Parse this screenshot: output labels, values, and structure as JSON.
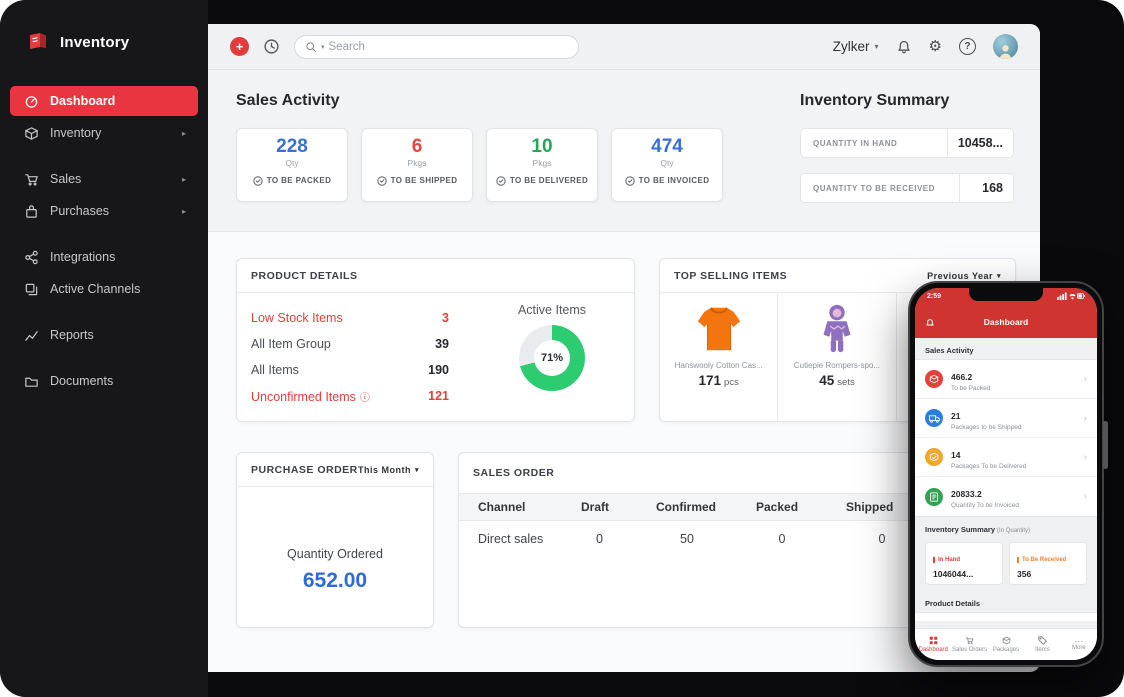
{
  "icons": {
    "plus": "+",
    "caret_down": "▾",
    "caret_right": "▸",
    "chevron_right": "›",
    "gear": "⚙",
    "question": "?",
    "info": "ⓘ",
    "dots": "⋯"
  },
  "colors": {
    "brand_red": "#e23b3b",
    "active_menu_red": "#e8353f",
    "blue_metric": "#3a6fd8",
    "red_metric": "#e8453c",
    "green_metric": "#27a45a",
    "donut_green": "#2ecc71",
    "donut_track": "#e9ebee",
    "alert_red": "#e0403a",
    "phone_header_red": "#cf3430"
  },
  "app": {
    "logo_text": "Inventory",
    "org_name": "Zylker",
    "search_placeholder": "Search"
  },
  "sidebar": {
    "items": [
      {
        "label": "Dashboard"
      },
      {
        "label": "Inventory"
      },
      {
        "label": "Sales"
      },
      {
        "label": "Purchases"
      },
      {
        "label": "Integrations"
      },
      {
        "label": "Active Channels"
      },
      {
        "label": "Reports"
      },
      {
        "label": "Documents"
      }
    ]
  },
  "sales_activity": {
    "title": "Sales Activity",
    "cards": [
      {
        "value": "228",
        "unit": "Qty",
        "label": "TO BE PACKED",
        "color": "#3a6fd8"
      },
      {
        "value": "6",
        "unit": "Pkgs",
        "label": "TO BE SHIPPED",
        "color": "#e8453c"
      },
      {
        "value": "10",
        "unit": "Pkgs",
        "label": "TO BE DELIVERED",
        "color": "#27a45a"
      },
      {
        "value": "474",
        "unit": "Qty",
        "label": "TO BE INVOICED",
        "color": "#3a6fd8"
      }
    ]
  },
  "inventory_summary": {
    "title": "Inventory Summary",
    "rows": [
      {
        "label": "QUANTITY IN HAND",
        "value": "10458..."
      },
      {
        "label": "QUANTITY TO BE RECEIVED",
        "value": "168"
      }
    ]
  },
  "product_details": {
    "title": "PRODUCT DETAILS",
    "rows": [
      {
        "label": "Low Stock Items",
        "value": "3"
      },
      {
        "label": "All Item Group",
        "value": "39"
      },
      {
        "label": "All Items",
        "value": "190"
      },
      {
        "label": "Unconfirmed Items",
        "value": "121"
      }
    ],
    "active_items": {
      "label": "Active Items",
      "percent_text": "71%",
      "percent": 71
    }
  },
  "top_selling_items": {
    "title": "TOP SELLING ITEMS",
    "filter_label": "Previous Year",
    "items": [
      {
        "name": "Hanswooly Cotton Cas...",
        "qty": "171",
        "unit": "pcs"
      },
      {
        "name": "Cutiepie Rompers-spo...",
        "qty": "45",
        "unit": "sets"
      }
    ]
  },
  "purchase_order": {
    "title": "PURCHASE ORDER",
    "filter_label": "This Month",
    "metric_label": "Quantity Ordered",
    "metric_value": "652.00"
  },
  "sales_order": {
    "title": "SALES ORDER",
    "columns": [
      "Channel",
      "Draft",
      "Confirmed",
      "Packed",
      "Shipped"
    ],
    "rows": [
      {
        "channel": "Direct sales",
        "draft": "0",
        "confirmed": "50",
        "packed": "0",
        "shipped": "0"
      }
    ]
  },
  "phone": {
    "status": {
      "time": "2:59"
    },
    "nav": {
      "title": "Dashboard"
    },
    "sales_activity_label": "Sales Activity",
    "activity_rows": [
      {
        "value": "466.2",
        "label": "To be Packed",
        "color": "#e2413c"
      },
      {
        "value": "21",
        "label": "Packages to be Shipped",
        "color": "#2b7de0"
      },
      {
        "value": "14",
        "label": "Packages To be Delivered",
        "color": "#f0a72f"
      },
      {
        "value": "20833.2",
        "label": "Quantity To be Invoiced",
        "color": "#33a253"
      }
    ],
    "inventory_summary_label": "Inventory Summary",
    "inventory_summary_suffix": "(In Quantity)",
    "summary_cards": [
      {
        "label": "In Hand",
        "value": "1046044...",
        "accent": "#e2413c"
      },
      {
        "label": "To Be Received",
        "value": "356",
        "accent": "#f0822f"
      }
    ],
    "product_details_label": "Product Details",
    "tabs": [
      {
        "label": "Dashboard"
      },
      {
        "label": "Sales Orders"
      },
      {
        "label": "Packages"
      },
      {
        "label": "Items"
      },
      {
        "label": "More"
      }
    ]
  }
}
